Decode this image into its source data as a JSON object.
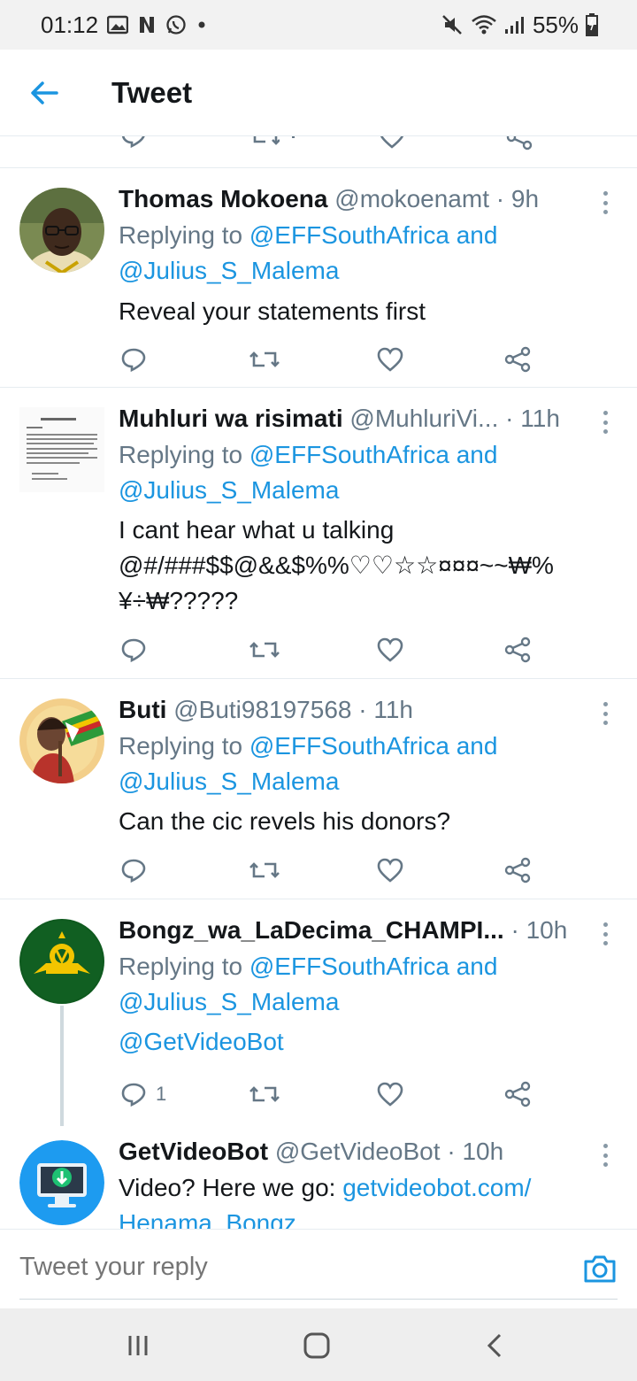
{
  "status_bar": {
    "time": "01:12",
    "battery": "55%",
    "icons": [
      "gallery-icon",
      "netflix-icon",
      "whatsapp-icon",
      "dot-icon",
      "mute-icon",
      "wifi-icon",
      "signal-icon",
      "battery-icon"
    ]
  },
  "header": {
    "title": "Tweet",
    "back_icon": "back-arrow-icon"
  },
  "colors": {
    "accent": "#1b95e0",
    "text": "#14171a",
    "secondary": "#657786",
    "divider": "#e6ecf0"
  },
  "tweets": [
    {
      "name": "Thomas Mokoena",
      "handle": "@mokoenamt",
      "sep": "·",
      "time": "9h",
      "replying_prefix": "Replying to",
      "replying_user1": "@EFFSouthAfrica",
      "replying_and": "and",
      "replying_user2": "@Julius_S_Malema",
      "text": "Reveal your statements first"
    },
    {
      "name": "Muhluri wa risimati",
      "handle": "@MuhluriVi...",
      "sep": "·",
      "time": "11h",
      "replying_prefix": "Replying to",
      "replying_user1": "@EFFSouthAfrica",
      "replying_and": "and",
      "replying_user2": "@Julius_S_Malema",
      "text_line1": "I cant hear what u talking",
      "text_line2": "@#/###$$@&&$%%♡♡☆☆¤¤¤~~₩%",
      "text_line3": "¥÷₩?????"
    },
    {
      "name": "Buti",
      "handle": "@Buti98197568",
      "sep": "·",
      "time": "11h",
      "replying_prefix": "Replying to",
      "replying_user1": "@EFFSouthAfrica",
      "replying_and": "and",
      "replying_user2": "@Julius_S_Malema",
      "text": "Can the cic revels his donors?"
    },
    {
      "name": "Bongz_wa_LaDecima_CHAMPI...",
      "handle": "",
      "sep": "·",
      "time": "10h",
      "replying_prefix": "Replying to",
      "replying_user1": "@EFFSouthAfrica",
      "replying_and": "and",
      "replying_user2": "@Julius_S_Malema",
      "text": "@GetVideoBot",
      "reply_count": "1"
    },
    {
      "name": "GetVideoBot",
      "handle": "@GetVideoBot",
      "sep": "·",
      "time": "10h",
      "text_prefix": "Video? Here we go:",
      "link_line1": "getvideobot.com/",
      "link_line2": "Henama_Bongz"
    }
  ],
  "reply_bar": {
    "placeholder": "Tweet your reply",
    "camera_icon": "camera-icon"
  },
  "nav_bar": {
    "icons": [
      "recent-apps-icon",
      "home-icon",
      "back-icon"
    ]
  }
}
